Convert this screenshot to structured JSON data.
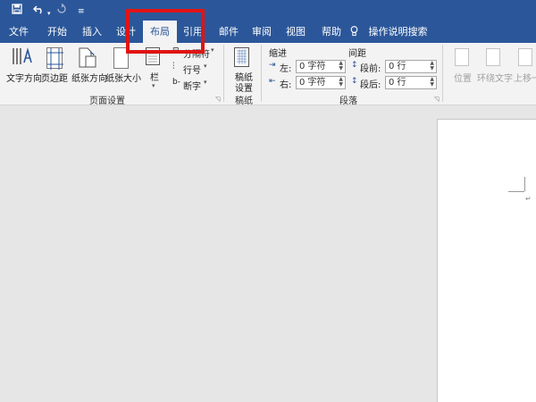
{
  "qat": {
    "save_icon": "save-icon",
    "undo_icon": "undo-icon",
    "redo_icon": "redo-icon",
    "customize_icon": "customize-icon"
  },
  "tabs": [
    {
      "label": "文件"
    },
    {
      "label": "开始"
    },
    {
      "label": "插入"
    },
    {
      "label": "设计"
    },
    {
      "label": "布局"
    },
    {
      "label": "引用"
    },
    {
      "label": "邮件"
    },
    {
      "label": "审阅"
    },
    {
      "label": "视图"
    },
    {
      "label": "帮助"
    }
  ],
  "search": {
    "label": "操作说明搜索",
    "icon": "lightbulb-icon"
  },
  "ribbon": {
    "text_direction": "文字方向",
    "margins": "页边距",
    "orientation": "纸张方向",
    "size": "纸张大小",
    "columns": "栏",
    "breaks": "分隔符",
    "line_numbers": "行号",
    "hyphenation": "断字",
    "page_setup_group": "页面设置",
    "manuscript_btn_line1": "稿纸",
    "manuscript_btn_line2": "设置",
    "manuscript_group": "稿纸",
    "indent_header": "缩进",
    "spacing_header": "间距",
    "indent_left_label": "左:",
    "indent_right_label": "右:",
    "indent_left_value": "0 字符",
    "indent_right_value": "0 字符",
    "spacing_before_label": "段前:",
    "spacing_after_label": "段后:",
    "spacing_before_value": "0 行",
    "spacing_after_value": "0 行",
    "paragraph_group": "段落",
    "position": "位置",
    "wrap_text": "环绕文字",
    "bring_forward": "上移一"
  },
  "colors": {
    "brand": "#2b579a",
    "highlight": "#e01414"
  }
}
